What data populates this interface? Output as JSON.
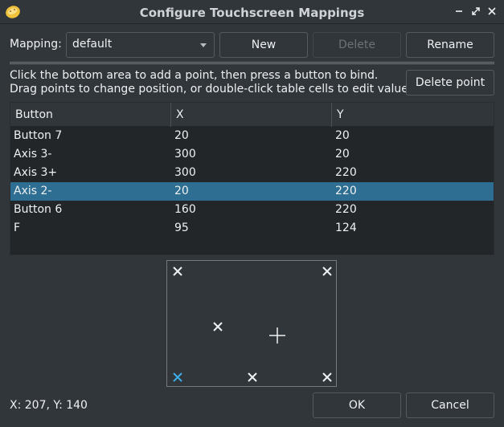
{
  "window": {
    "title": "Configure Touchscreen Mappings",
    "icon": "app-cookie-icon",
    "controls": [
      "minimize-icon",
      "restore-icon",
      "close-icon"
    ]
  },
  "mapping": {
    "label": "Mapping:",
    "selected": "default",
    "new_label": "New",
    "delete_label": "Delete",
    "rename_label": "Rename"
  },
  "instructions": {
    "line1": "Click the bottom area to add a point, then press a button to bind.",
    "line2": "Drag points to change position, or double-click table cells to edit values.",
    "delete_point_label": "Delete point"
  },
  "table": {
    "headers": [
      "Button",
      "X",
      "Y"
    ],
    "rows": [
      {
        "button": "Button 7",
        "x": "20",
        "y": "20"
      },
      {
        "button": "Axis 3-",
        "x": "300",
        "y": "20"
      },
      {
        "button": "Axis 3+",
        "x": "300",
        "y": "220"
      },
      {
        "button": "Axis 2-",
        "x": "20",
        "y": "220"
      },
      {
        "button": "Button 6",
        "x": "160",
        "y": "220"
      },
      {
        "button": "F",
        "x": "95",
        "y": "124"
      }
    ],
    "selected_row": 3
  },
  "colors": {
    "selection": "#2d6e92",
    "selected_marker": "#3daee9",
    "marker": "#eff0f1"
  },
  "footer": {
    "coords": "X: 207, Y: 140",
    "ok_label": "OK",
    "cancel_label": "Cancel"
  }
}
